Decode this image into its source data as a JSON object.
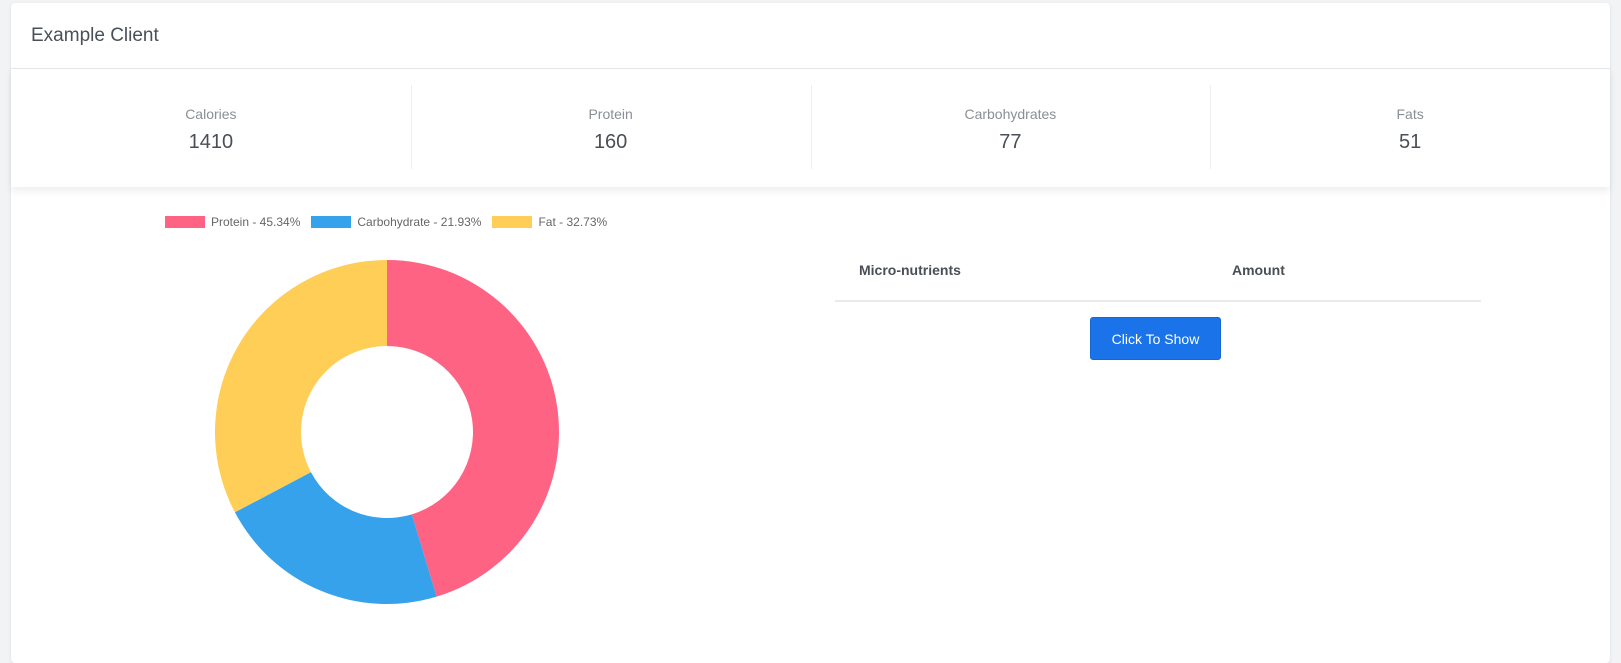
{
  "header": {
    "title": "Example Client"
  },
  "stats": [
    {
      "label": "Calories",
      "value": "1410"
    },
    {
      "label": "Protein",
      "value": "160"
    },
    {
      "label": "Carbohydrates",
      "value": "77"
    },
    {
      "label": "Fats",
      "value": "51"
    }
  ],
  "chart_data": {
    "type": "pie",
    "variant": "doughnut",
    "legend_position": "top",
    "categories": [
      "Protein - 45.34%",
      "Carbohydrate - 21.93%",
      "Fat - 32.73%"
    ],
    "values": [
      45.34,
      21.93,
      32.73
    ],
    "colors": [
      "#ff6384",
      "#36a2eb",
      "#ffce56"
    ]
  },
  "micro_table": {
    "columns": [
      "Micro-nutrients",
      "Amount"
    ],
    "button_label": "Click To Show"
  }
}
